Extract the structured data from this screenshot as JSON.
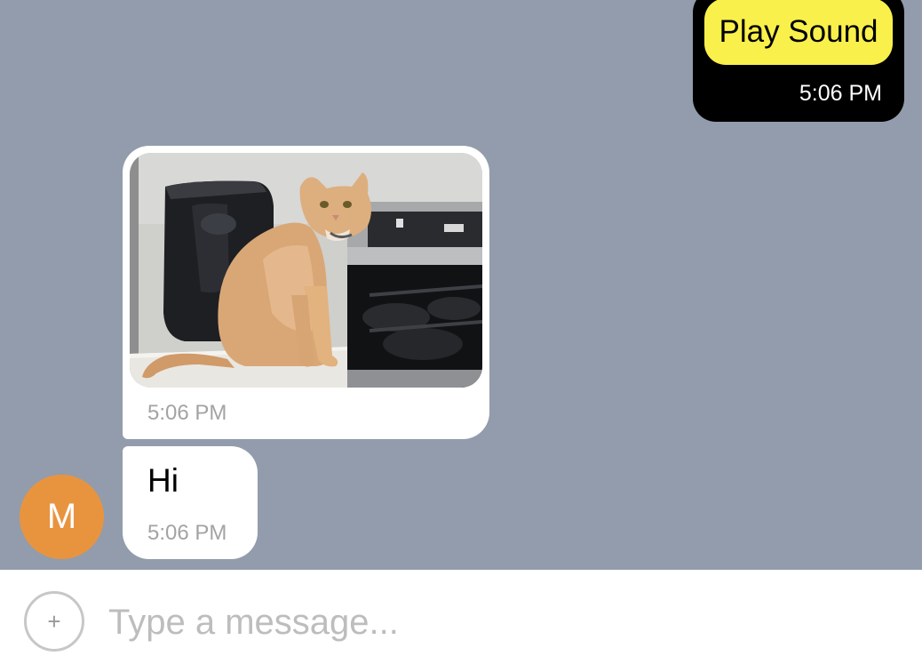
{
  "messages": {
    "outgoing": {
      "button_label": "Play Sound",
      "time": "5:06 PM"
    },
    "incoming_image": {
      "time": "5:06 PM"
    },
    "incoming_text": {
      "text": "Hi",
      "time": "5:06 PM"
    }
  },
  "avatar": {
    "initial": "M",
    "color": "#E8943F"
  },
  "composer": {
    "placeholder": "Type a message...",
    "add_icon": "plus-icon"
  },
  "colors": {
    "chat_background": "#929CAC",
    "outgoing_bubble": "#000000",
    "action_button": "#FAF04B",
    "incoming_bubble": "#FFFFFF"
  }
}
